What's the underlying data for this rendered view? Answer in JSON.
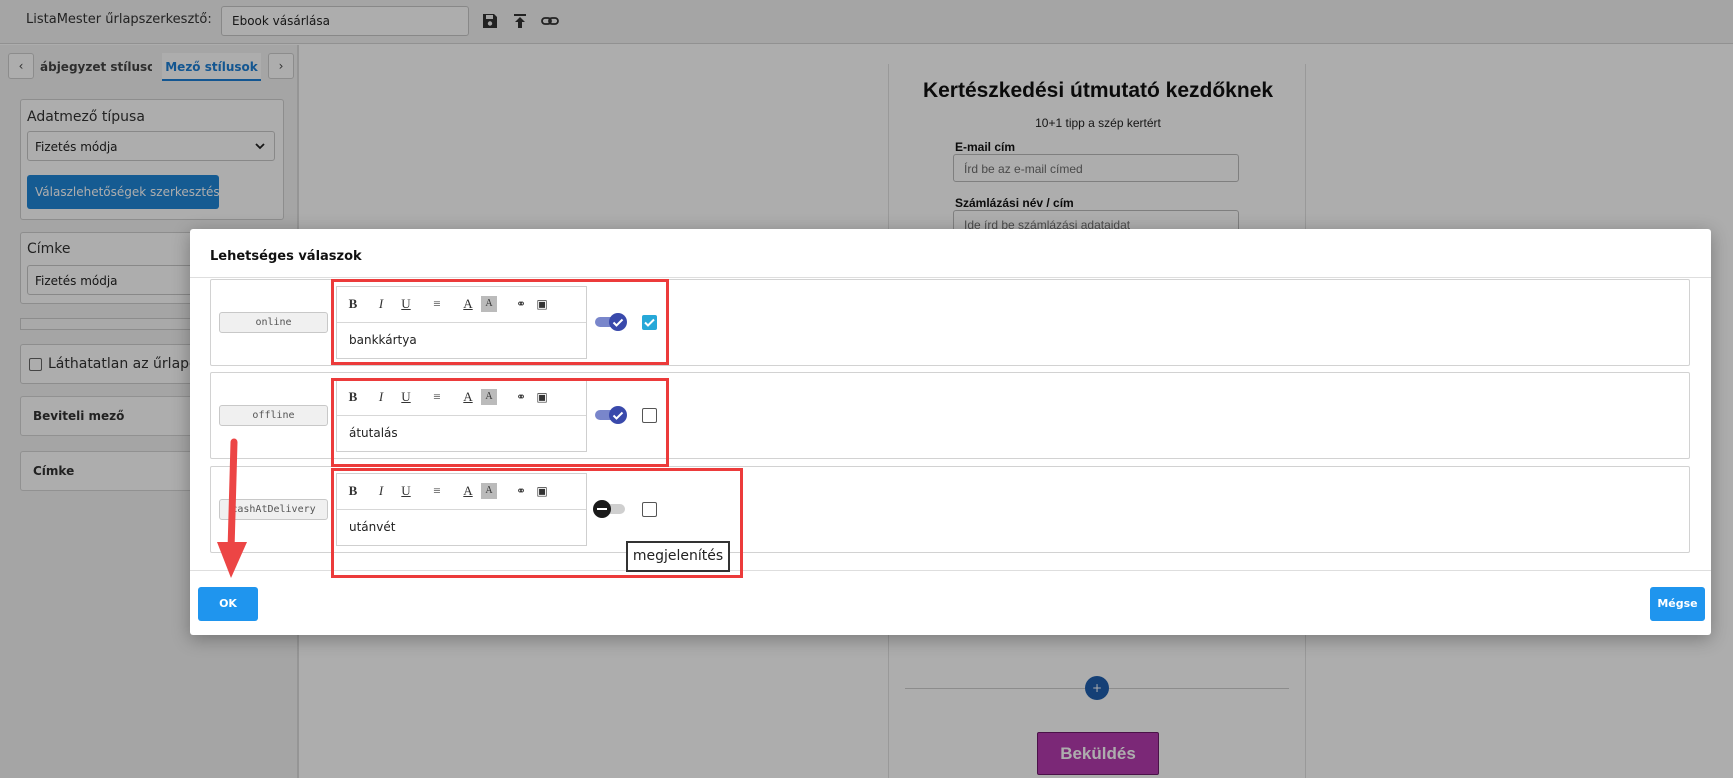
{
  "topbar": {
    "app_title": "ListaMester űrlapszerkesztő:",
    "form_name": "Ebook vásárlása"
  },
  "sidebar": {
    "tabs": [
      "ábjegyzet stílusok",
      "Mező stílusok"
    ],
    "field_type_label": "Adatmező típusa",
    "field_type_value": "Fizetés módja",
    "edit_options_button": "Válaszlehetőségek szerkesztése",
    "label_section": "Címke",
    "label_value": "Fizetés módja",
    "invisible_checkbox": "Láthatatlan az űrlapo",
    "accordions": [
      "Beviteli mező",
      "Címke"
    ]
  },
  "preview": {
    "title": "Kertészkedési útmutató kezdőknek",
    "subtitle": "10+1 tipp a szép kertért",
    "email_label": "E-mail cím",
    "email_placeholder": "Írd be az e-mail címed",
    "billing_label": "Számlázási név / cím",
    "billing_placeholder": "Ide írd be számlázási adataidat",
    "plus": "+",
    "submit_button": "Beküldés"
  },
  "modal": {
    "title": "Lehetséges válaszok",
    "rows": [
      {
        "code": "online",
        "text": "bankkártya",
        "enabled": true,
        "checked": true
      },
      {
        "code": "offline",
        "text": "átutalás",
        "enabled": true,
        "checked": false
      },
      {
        "code": "cashAtDelivery",
        "text": "utánvét",
        "enabled": false,
        "checked": false
      }
    ],
    "toolbar_icons": [
      "bold-icon",
      "italic-icon",
      "underline-icon",
      "align-icon",
      "font-color-icon",
      "background-color-icon",
      "link-icon",
      "image-icon"
    ],
    "tooltip": "megjelenítés",
    "ok_button": "OK",
    "cancel_button": "Mégse"
  },
  "colors": {
    "accent_blue": "#1f95ee",
    "toggle_on": "#3949ab",
    "checkbox_checked": "#26a8d8",
    "highlight_red": "#ec3b3b",
    "submit_purple": "#b63bb0"
  }
}
